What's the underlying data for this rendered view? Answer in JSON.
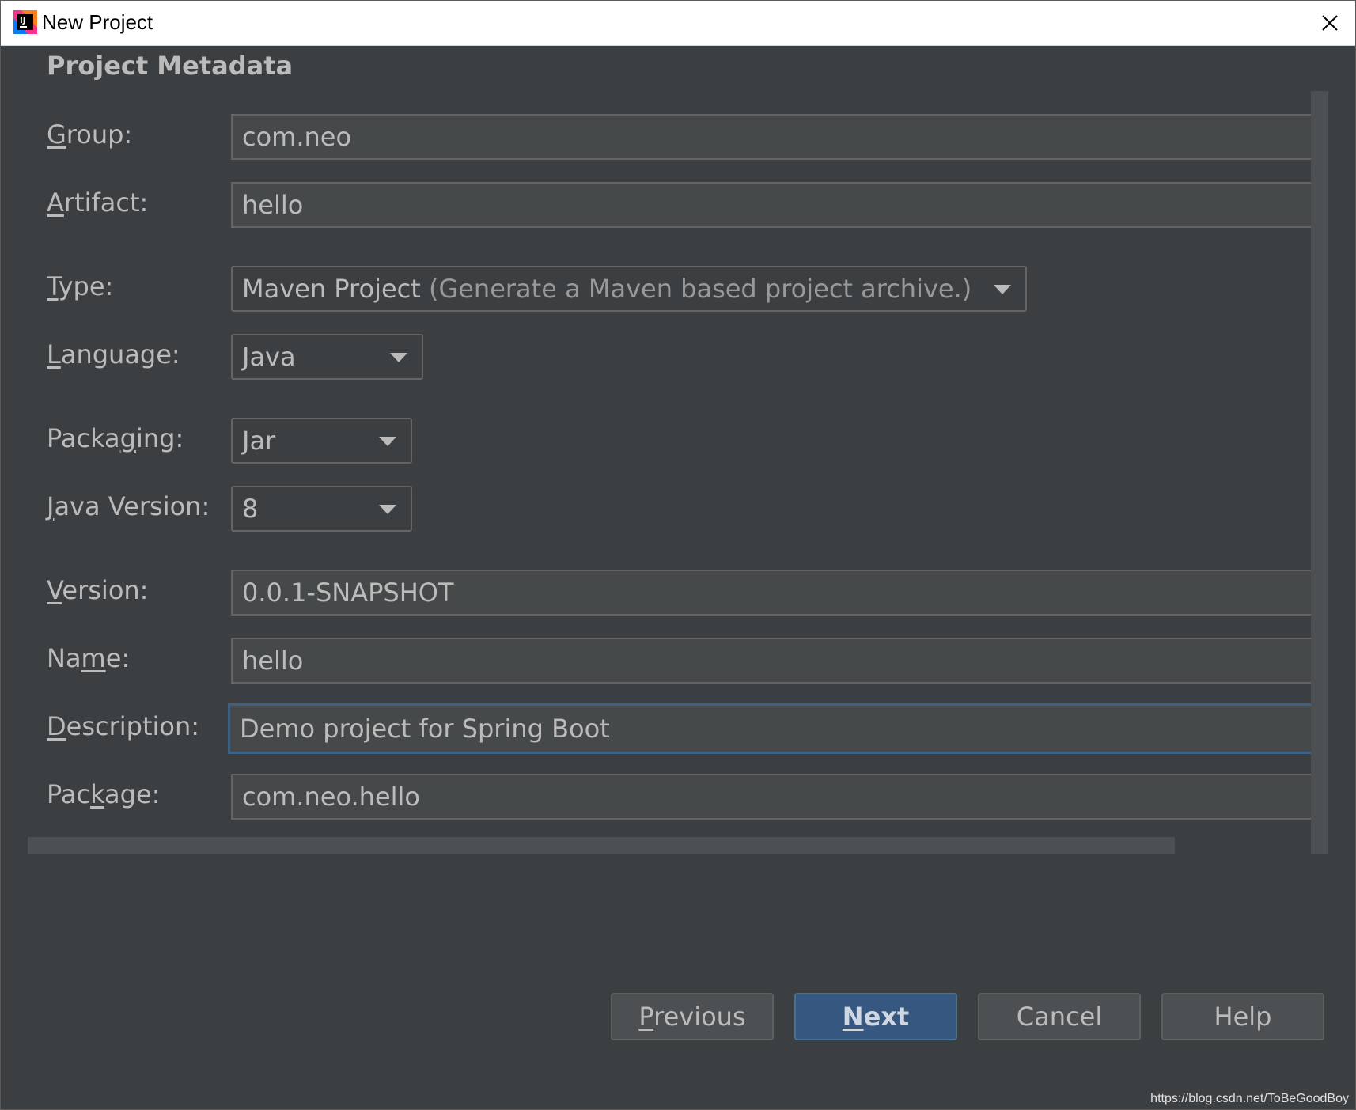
{
  "window": {
    "title": "New Project"
  },
  "section": {
    "title": "Project Metadata"
  },
  "form": {
    "group": {
      "label_mnemonic": "G",
      "label_rest": "roup:",
      "value": "com.neo"
    },
    "artifact": {
      "label_mnemonic": "A",
      "label_rest": "rtifact:",
      "value": "hello"
    },
    "type": {
      "label_mnemonic": "T",
      "label_rest": "ype:",
      "value": "Maven Project",
      "hint": "(Generate a Maven based project archive.)"
    },
    "language": {
      "label_mnemonic": "L",
      "label_rest": "anguage:",
      "value": "Java"
    },
    "packaging": {
      "label_pre": "Packa",
      "label_mnemonic": "g",
      "label_rest": "ing:",
      "value": "Jar"
    },
    "java_version": {
      "label_mnemonic": "J",
      "label_rest": "ava Version:",
      "value": "8"
    },
    "version": {
      "label_mnemonic": "V",
      "label_rest": "ersion:",
      "value": "0.0.1-SNAPSHOT"
    },
    "name": {
      "label_pre": "Na",
      "label_mnemonic": "m",
      "label_rest": "e:",
      "value": "hello"
    },
    "description": {
      "label_mnemonic": "D",
      "label_rest": "escription:",
      "value": "Demo project for Spring Boot"
    },
    "package": {
      "label_pre": "Pac",
      "label_mnemonic": "k",
      "label_rest": "age:",
      "value": "com.neo.hello"
    }
  },
  "buttons": {
    "previous": {
      "mnemonic": "P",
      "rest": "revious"
    },
    "next": {
      "mnemonic": "N",
      "rest": "ext"
    },
    "cancel": {
      "label": "Cancel"
    },
    "help": {
      "label": "Help"
    }
  },
  "watermark": "https://blog.csdn.net/ToBeGoodBoy",
  "colors": {
    "background": "#3c3f41",
    "field_bg": "#45494a",
    "text": "#bbbbbb",
    "primary_button": "#365880",
    "focus_border": "#3d6185"
  },
  "icons": {
    "app": "intellij-idea-icon",
    "close": "close-icon",
    "dropdown": "chevron-down-icon"
  }
}
